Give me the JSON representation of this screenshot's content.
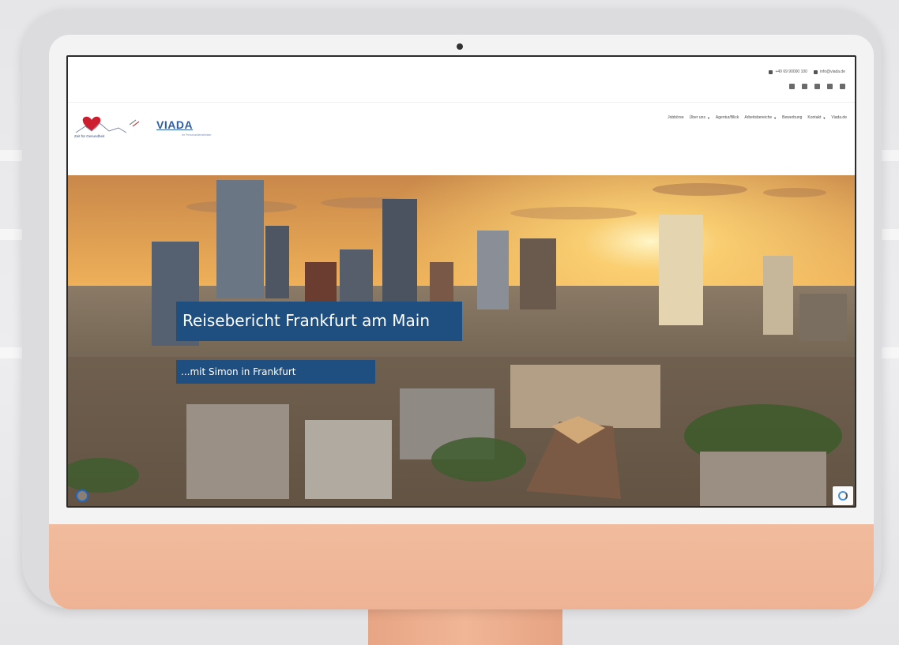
{
  "topbar": {
    "phone": "+49 69 90000 100",
    "email": "info@viada.de",
    "social_icons": [
      "facebook-icon",
      "instagram-icon",
      "linkedin-icon",
      "xing-icon",
      "youtube-icon"
    ]
  },
  "header": {
    "logo_text": "VIADA",
    "logo_subtext": "Ihr Personaldienstleister",
    "partner_logo_text": "Zeit für Gesundheit"
  },
  "nav": {
    "items": [
      {
        "label": "Jobbörse",
        "has_caret": false
      },
      {
        "label": "Über uns",
        "has_caret": true
      },
      {
        "label": "Agentur/Blick",
        "has_caret": false
      },
      {
        "label": "Arbeitsbereiche",
        "has_caret": true
      },
      {
        "label": "Bewerbung",
        "has_caret": false
      },
      {
        "label": "Kontakt",
        "has_caret": true
      },
      {
        "label": "Viada.de",
        "has_caret": false
      }
    ]
  },
  "hero": {
    "title": "Reisebericht Frankfurt am Main",
    "subtitle": "...mit Simon in Frankfurt"
  },
  "colors": {
    "accent_blue": "#1e4f80",
    "monitor_peach": "#f0b696",
    "bezel": "#f3f3f3"
  }
}
